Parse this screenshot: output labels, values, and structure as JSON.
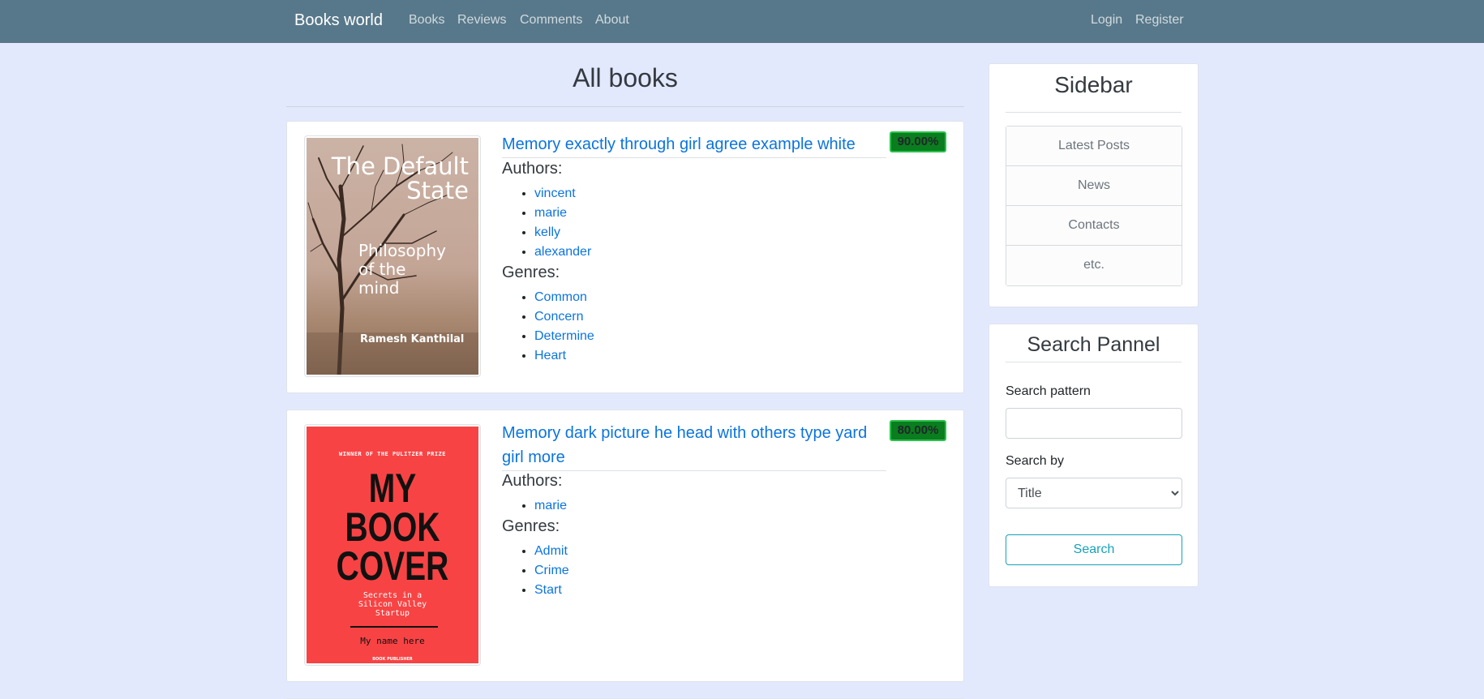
{
  "navbar": {
    "brand": "Books world",
    "links": [
      "Books",
      "Reviews",
      "Comments",
      "About"
    ],
    "right_links": [
      "Login",
      "Register"
    ],
    "background": "#57788a"
  },
  "main": {
    "title": "All books",
    "books": [
      {
        "title": "Memory exactly through girl agree example white",
        "score": "90.00%",
        "authors_heading": "Authors:",
        "authors": [
          "vincent",
          "marie",
          "kelly",
          "alexander"
        ],
        "genres_heading": "Genres:",
        "genres": [
          "Common",
          "Concern",
          "Determine",
          "Heart"
        ],
        "cover": {
          "title_line1": "The Default",
          "title_line2": "State",
          "subtitle_line1": "Philosophy",
          "subtitle_line2": "of the",
          "subtitle_line3": "mind",
          "author": "Ramesh Kanthilal"
        }
      },
      {
        "title": "Memory dark picture he head with others type yard girl more",
        "score": "80.00%",
        "authors_heading": "Authors:",
        "authors": [
          "marie"
        ],
        "genres_heading": "Genres:",
        "genres": [
          "Admit",
          "Crime",
          "Start"
        ],
        "cover": {
          "prize": "WINNER OF THE PULITZER PRIZE",
          "line1": "MY",
          "line2": "BOOK",
          "line3": "COVER",
          "tag1": "Secrets in a",
          "tag2": "Silicon Valley",
          "tag3": "Startup",
          "name": "My name here",
          "publisher": "BOOK PUBLISHER"
        }
      }
    ]
  },
  "sidebar": {
    "title": "Sidebar",
    "items": [
      "Latest Posts",
      "News",
      "Contacts",
      "etc."
    ]
  },
  "search": {
    "title": "Search Pannel",
    "pattern_label": "Search pattern",
    "pattern_value": "",
    "by_label": "Search by",
    "by_selected": "Title",
    "button": "Search"
  },
  "colors": {
    "page_bg": "#e3e9fd",
    "link": "#0b74de",
    "score_bg": "#0a7d1e",
    "search_button": "#17a2b8"
  }
}
